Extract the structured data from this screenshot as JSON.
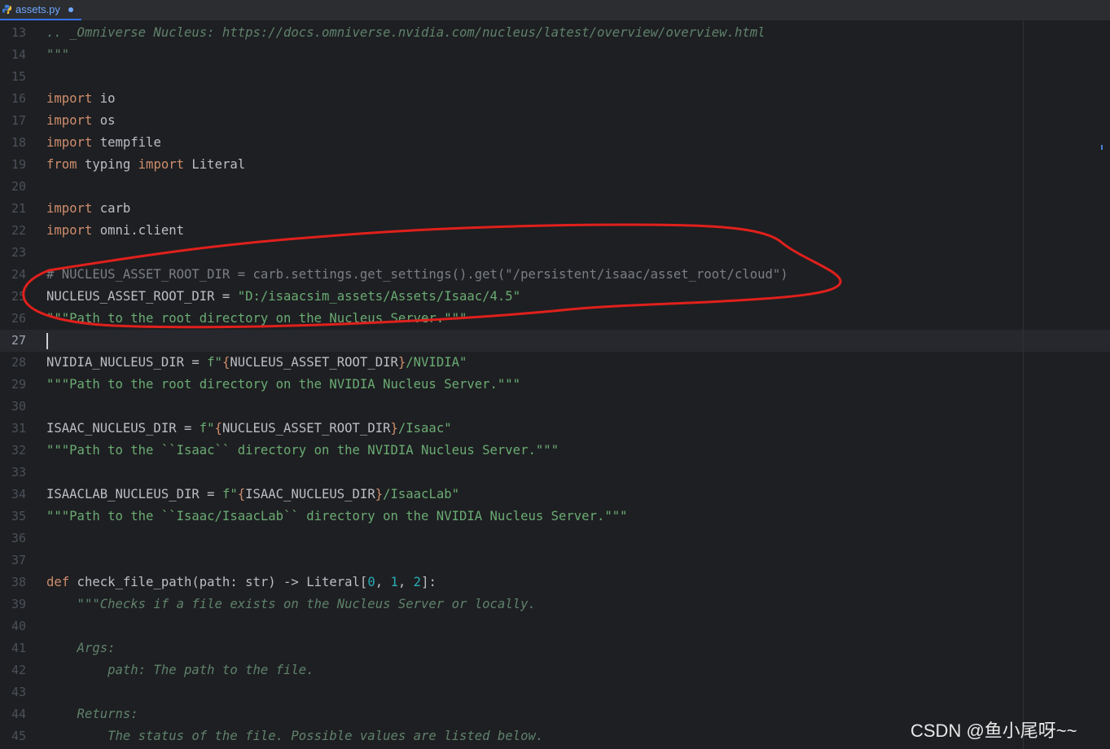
{
  "tab": {
    "filename": "assets.py",
    "icon": "python-file-icon",
    "modified_dot_color": "#6fa7ff"
  },
  "lines": [
    {
      "num": "13",
      "parts": [
        {
          "c": "doc",
          "t": ".. _Omniverse Nucleus: https://docs.omniverse.nvidia.com/nucleus/latest/overview/overview.html"
        }
      ]
    },
    {
      "num": "14",
      "parts": [
        {
          "c": "doc",
          "t": "\"\"\""
        }
      ]
    },
    {
      "num": "15",
      "parts": []
    },
    {
      "num": "16",
      "parts": [
        {
          "c": "kw",
          "t": "import"
        },
        {
          "c": "",
          "t": " io"
        }
      ]
    },
    {
      "num": "17",
      "parts": [
        {
          "c": "kw",
          "t": "import"
        },
        {
          "c": "",
          "t": " os"
        }
      ]
    },
    {
      "num": "18",
      "parts": [
        {
          "c": "kw",
          "t": "import"
        },
        {
          "c": "",
          "t": " tempfile"
        }
      ]
    },
    {
      "num": "19",
      "parts": [
        {
          "c": "kw",
          "t": "from"
        },
        {
          "c": "",
          "t": " typing "
        },
        {
          "c": "kw",
          "t": "import"
        },
        {
          "c": "",
          "t": " Literal"
        }
      ]
    },
    {
      "num": "20",
      "parts": []
    },
    {
      "num": "21",
      "parts": [
        {
          "c": "kw",
          "t": "import"
        },
        {
          "c": "",
          "t": " carb"
        }
      ]
    },
    {
      "num": "22",
      "parts": [
        {
          "c": "kw",
          "t": "import"
        },
        {
          "c": "",
          "t": " omni.client"
        }
      ]
    },
    {
      "num": "23",
      "parts": []
    },
    {
      "num": "24",
      "parts": [
        {
          "c": "cmt",
          "t": "# NUCLEUS_ASSET_ROOT_DIR = carb.settings.get_settings().get(\"/persistent/isaac/asset_root/cloud\")"
        }
      ]
    },
    {
      "num": "25",
      "parts": [
        {
          "c": "",
          "t": "NUCLEUS_ASSET_ROOT_DIR = "
        },
        {
          "c": "str",
          "t": "\"D:/isaacsim_assets/Assets/Isaac/4.5\""
        }
      ]
    },
    {
      "num": "26",
      "parts": [
        {
          "c": "str",
          "t": "\"\"\"Path to the root directory on the Nucleus Server.\"\"\""
        }
      ]
    },
    {
      "num": "27",
      "current": true,
      "parts": []
    },
    {
      "num": "28",
      "parts": [
        {
          "c": "",
          "t": "NVIDIA_NUCLEUS_DIR = "
        },
        {
          "c": "str",
          "t": "f\""
        },
        {
          "c": "brace",
          "t": "{"
        },
        {
          "c": "",
          "t": "NUCLEUS_ASSET_ROOT_DIR"
        },
        {
          "c": "brace",
          "t": "}"
        },
        {
          "c": "str",
          "t": "/NVIDIA\""
        }
      ]
    },
    {
      "num": "29",
      "parts": [
        {
          "c": "str",
          "t": "\"\"\"Path to the root directory on the NVIDIA Nucleus Server.\"\"\""
        }
      ]
    },
    {
      "num": "30",
      "parts": []
    },
    {
      "num": "31",
      "parts": [
        {
          "c": "",
          "t": "ISAAC_NUCLEUS_DIR = "
        },
        {
          "c": "str",
          "t": "f\""
        },
        {
          "c": "brace",
          "t": "{"
        },
        {
          "c": "",
          "t": "NUCLEUS_ASSET_ROOT_DIR"
        },
        {
          "c": "brace",
          "t": "}"
        },
        {
          "c": "str",
          "t": "/Isaac\""
        }
      ]
    },
    {
      "num": "32",
      "parts": [
        {
          "c": "str",
          "t": "\"\"\"Path to the ``Isaac`` directory on the NVIDIA Nucleus Server.\"\"\""
        }
      ]
    },
    {
      "num": "33",
      "parts": []
    },
    {
      "num": "34",
      "parts": [
        {
          "c": "",
          "t": "ISAACLAB_NUCLEUS_DIR = "
        },
        {
          "c": "str",
          "t": "f\""
        },
        {
          "c": "brace",
          "t": "{"
        },
        {
          "c": "",
          "t": "ISAAC_NUCLEUS_DIR"
        },
        {
          "c": "brace",
          "t": "}"
        },
        {
          "c": "str",
          "t": "/IsaacLab\""
        }
      ]
    },
    {
      "num": "35",
      "parts": [
        {
          "c": "str",
          "t": "\"\"\"Path to the ``Isaac/IsaacLab`` directory on the NVIDIA Nucleus Server.\"\"\""
        }
      ]
    },
    {
      "num": "36",
      "parts": []
    },
    {
      "num": "37",
      "parts": []
    },
    {
      "num": "38",
      "parts": [
        {
          "c": "kw",
          "t": "def"
        },
        {
          "c": "",
          "t": " check_file_path(path: str) -> Literal["
        },
        {
          "c": "num",
          "t": "0"
        },
        {
          "c": "",
          "t": ", "
        },
        {
          "c": "num",
          "t": "1"
        },
        {
          "c": "",
          "t": ", "
        },
        {
          "c": "num",
          "t": "2"
        },
        {
          "c": "",
          "t": "]:"
        }
      ]
    },
    {
      "num": "39",
      "parts": [
        {
          "c": "doc",
          "t": "    \"\"\"Checks if a file exists on the Nucleus Server or locally."
        }
      ]
    },
    {
      "num": "40",
      "parts": []
    },
    {
      "num": "41",
      "parts": [
        {
          "c": "doc",
          "t": "    Args:"
        }
      ]
    },
    {
      "num": "42",
      "parts": [
        {
          "c": "doc",
          "t": "        path: The path to the file."
        }
      ]
    },
    {
      "num": "43",
      "parts": []
    },
    {
      "num": "44",
      "parts": [
        {
          "c": "doc",
          "t": "    Returns:"
        }
      ]
    },
    {
      "num": "45",
      "parts": [
        {
          "c": "doc",
          "t": "        The status of the file. Possible values are listed below."
        }
      ]
    }
  ],
  "annotation": {
    "shape": "freehand-ellipse",
    "color": "#e0201c"
  },
  "watermark": "CSDN @鱼小尾呀~~"
}
